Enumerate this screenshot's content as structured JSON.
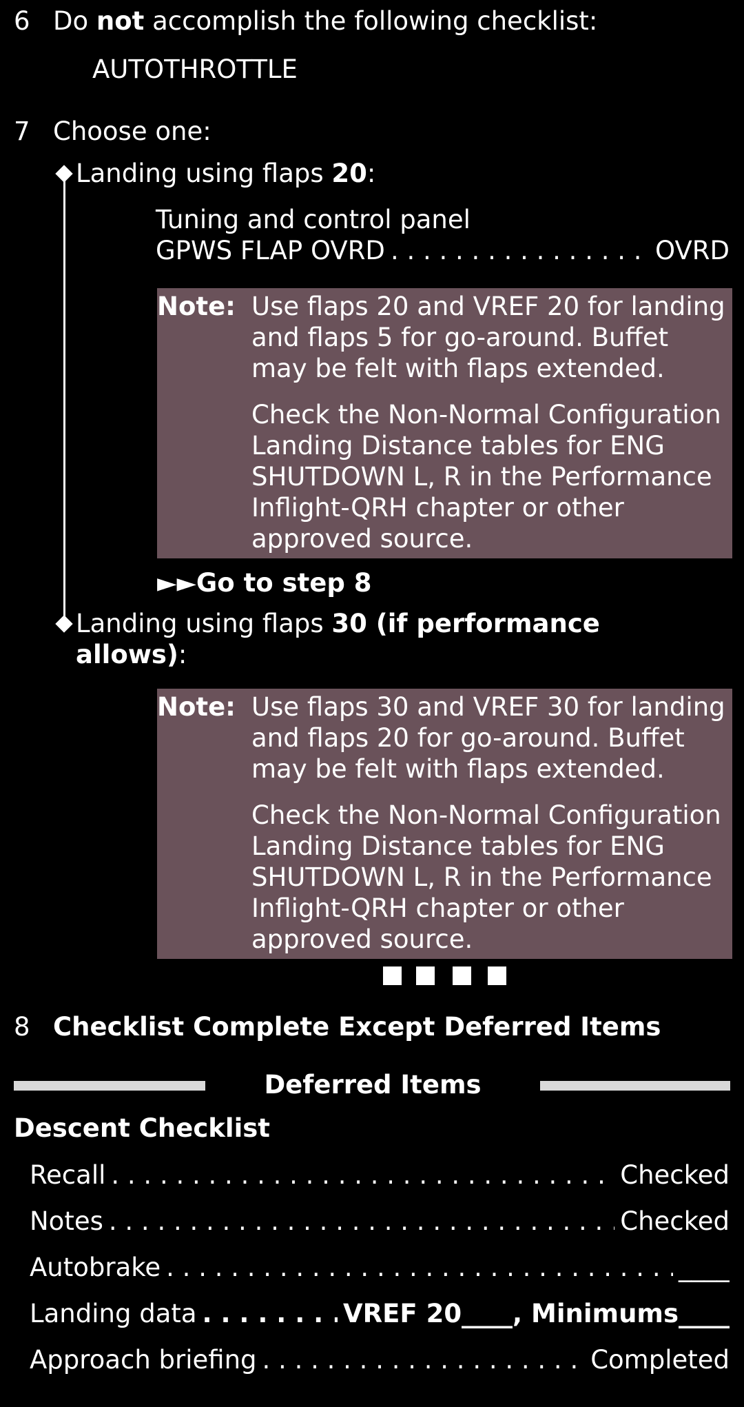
{
  "step6": {
    "number": "6",
    "text_before": "Do ",
    "text_bold": "not",
    "text_after": " accomplish the following checklist:",
    "checklist": "AUTOTHROTTLE"
  },
  "step7": {
    "number": "7",
    "text": "Choose one:",
    "option1": {
      "label_prefix": "Landing using flaps ",
      "label_bold": "20",
      "label_suffix": ":",
      "panel": "Tuning and control panel",
      "action_label": "GPWS FLAP OVRD",
      "action_value": "OVRD",
      "note_label": "Note:",
      "note_p1": "Use flaps 20 and VREF 20 for landing and flaps 5 for go-around. Buffet may be felt with flaps extended.",
      "note_p2": "Check the Non-Normal Configuration Landing Distance tables for ENG SHUTDOWN L, R in the Performance Inflight-QRH chapter or other approved source.",
      "goto_arrows": "►►",
      "goto_text": "Go to step 8"
    },
    "option2": {
      "label_prefix": "Landing using flaps ",
      "label_bold_line1": "30 (if performance",
      "label_bold_line2": "allows)",
      "label_suffix": ":",
      "note_label": "Note:",
      "note_p1": "Use flaps 30 and VREF 30 for landing and flaps 20 for go-around. Buffet may be felt with flaps extended.",
      "note_p2": "Check the Non-Normal Configuration Landing Distance tables for ENG SHUTDOWN L, R in the Performance Inflight-QRH chapter or other approved source."
    }
  },
  "step8": {
    "number": "8",
    "text": "Checklist Complete Except Deferred Items"
  },
  "deferred": {
    "header": "Deferred Items",
    "section_title": "Descent Checklist",
    "items": [
      {
        "label": "Recall",
        "value": "Checked"
      },
      {
        "label": "Notes",
        "value": "Checked"
      },
      {
        "label": "Autobrake",
        "value": "____"
      },
      {
        "label": "Landing data",
        "value": "VREF 20____, Minimums____"
      },
      {
        "label": "Approach briefing",
        "value": "Completed"
      }
    ]
  }
}
